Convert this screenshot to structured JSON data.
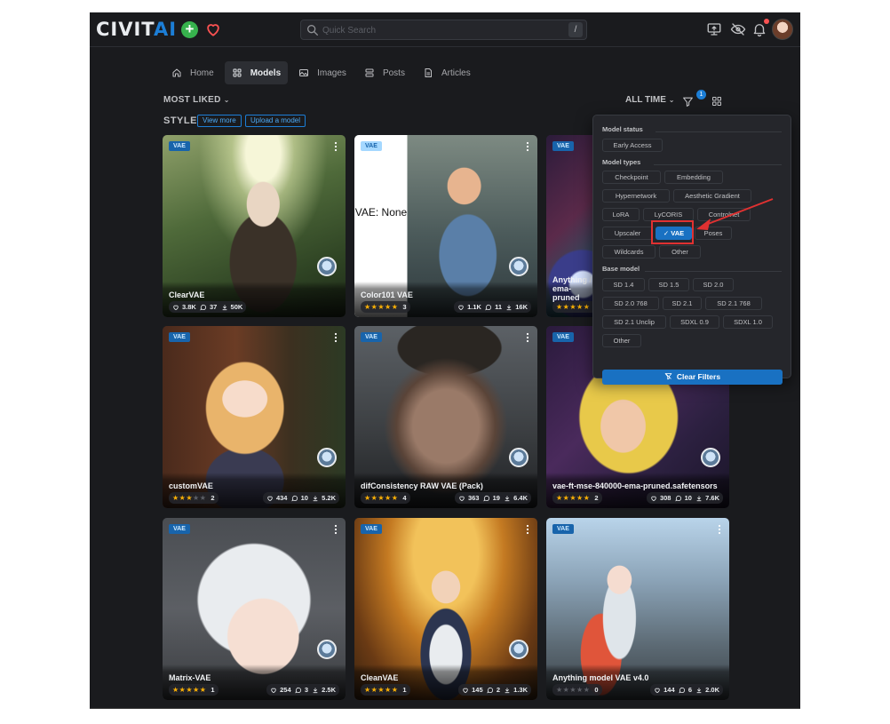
{
  "header": {
    "logo_main": "CIVIT",
    "logo_accent": "AI",
    "search_placeholder": "Quick Search",
    "search_shortcut": "/"
  },
  "nav": {
    "tabs": [
      {
        "label": "Home",
        "icon": "home-icon"
      },
      {
        "label": "Models",
        "icon": "models-grid-icon",
        "active": true
      },
      {
        "label": "Images",
        "icon": "photo-icon"
      },
      {
        "label": "Posts",
        "icon": "posts-icon"
      },
      {
        "label": "Articles",
        "icon": "article-icon"
      }
    ]
  },
  "toolbar": {
    "sort_label": "MOST LIKED",
    "period_label": "ALL TIME",
    "filter_count": "1"
  },
  "section": {
    "title": "STYLE",
    "view_more": "View more",
    "upload": "Upload a model"
  },
  "cards": [
    {
      "badge": "VAE",
      "title": "ClearVAE",
      "rating": null,
      "likes": "3.8K",
      "comments": "37",
      "downloads": "50K"
    },
    {
      "badge": "VAE",
      "title": "Color101 VAE",
      "rating": 5,
      "rating_count": "3",
      "likes": "1.1K",
      "comments": "11",
      "downloads": "16K",
      "placeholder": "VAE: None"
    },
    {
      "badge": "VAE",
      "title": "Anything / ema-pruned",
      "rating": 5,
      "rating_count": "",
      "likes": "",
      "comments": "",
      "downloads": ""
    },
    {
      "badge": "VAE",
      "title": "customVAE",
      "rating": 3,
      "rating_count": "2",
      "likes": "434",
      "comments": "10",
      "downloads": "5.2K"
    },
    {
      "badge": "VAE",
      "title": "difConsistency RAW VAE (Pack)",
      "rating": 5,
      "rating_count": "4",
      "likes": "363",
      "comments": "19",
      "downloads": "6.4K"
    },
    {
      "badge": "VAE",
      "title": "vae-ft-mse-840000-ema-pruned.safetensors",
      "rating": 5,
      "rating_count": "2",
      "likes": "308",
      "comments": "10",
      "downloads": "7.6K"
    },
    {
      "badge": "VAE",
      "title": "Matrix-VAE",
      "rating": 5,
      "rating_count": "1",
      "likes": "254",
      "comments": "3",
      "downloads": "2.5K"
    },
    {
      "badge": "VAE",
      "title": "CleanVAE",
      "rating": 5,
      "rating_count": "1",
      "likes": "145",
      "comments": "2",
      "downloads": "1.3K"
    },
    {
      "badge": "VAE",
      "title": "Anything model VAE v4.0",
      "rating": 0,
      "rating_count": "0",
      "likes": "144",
      "comments": "6",
      "downloads": "2.0K"
    }
  ],
  "filters": {
    "model_status_label": "Model status",
    "model_status": [
      "Early Access"
    ],
    "model_types_label": "Model types",
    "model_types": [
      "Checkpoint",
      "Embedding",
      "Hypernetwork",
      "Aesthetic Gradient",
      "LoRA",
      "LyCORIS",
      "Controlnet",
      "Upscaler",
      "VAE",
      "Poses",
      "Wildcards",
      "Other"
    ],
    "selected_type": "VAE",
    "base_model_label": "Base model",
    "base_models": [
      "SD 1.4",
      "SD 1.5",
      "SD 2.0",
      "SD 2.0 768",
      "SD 2.1",
      "SD 2.1 768",
      "SD 2.1 Unclip",
      "SDXL 0.9",
      "SDXL 1.0",
      "Other"
    ],
    "clear_label": "Clear Filters"
  },
  "colors": {
    "background": "#1a1b1e",
    "accent": "#1971c2",
    "annotation": "#e03131",
    "star": "#fab005"
  }
}
